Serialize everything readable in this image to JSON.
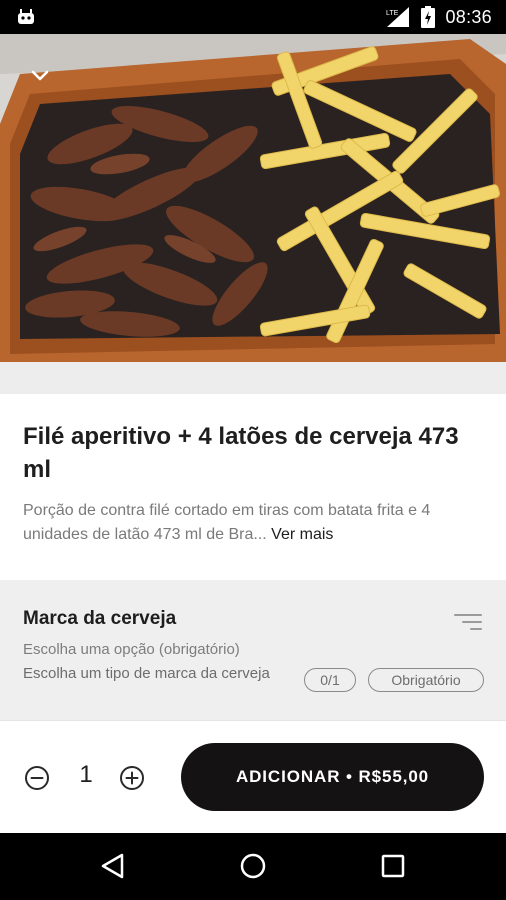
{
  "status_bar": {
    "time": "08:36",
    "network": "LTE",
    "icons": [
      "android-robot-icon",
      "signal-lte-icon",
      "battery-charging-icon"
    ]
  },
  "hero": {
    "image": "steak-and-fries-platter",
    "back_icon": "chevron-down-icon"
  },
  "product": {
    "title": "Filé aperitivo + 4 latões de cerveja 473 ml",
    "description": "Porção de contra filé cortado em tiras com batata frita e 4 unidades de latão 473 ml de Bra...",
    "see_more": "Ver mais"
  },
  "option_group": {
    "title": "Marca da cerveja",
    "subtitle": "Escolha uma opção (obrigatório)",
    "description": "Escolha um tipo de marca da cerveja",
    "count_badge": "0/1",
    "required_badge": "Obrigatório",
    "icon": "filter-lines-icon"
  },
  "action_bar": {
    "quantity": "1",
    "add_label": "ADICIONAR • R$55,00"
  },
  "nav_bar": {
    "icons": [
      "back-triangle-icon",
      "home-circle-icon",
      "recents-square-icon"
    ]
  },
  "colors": {
    "button_bg": "#141212",
    "section_bg": "#efefef",
    "text_primary": "#1e1e1e",
    "text_secondary": "#7a7a7a"
  }
}
